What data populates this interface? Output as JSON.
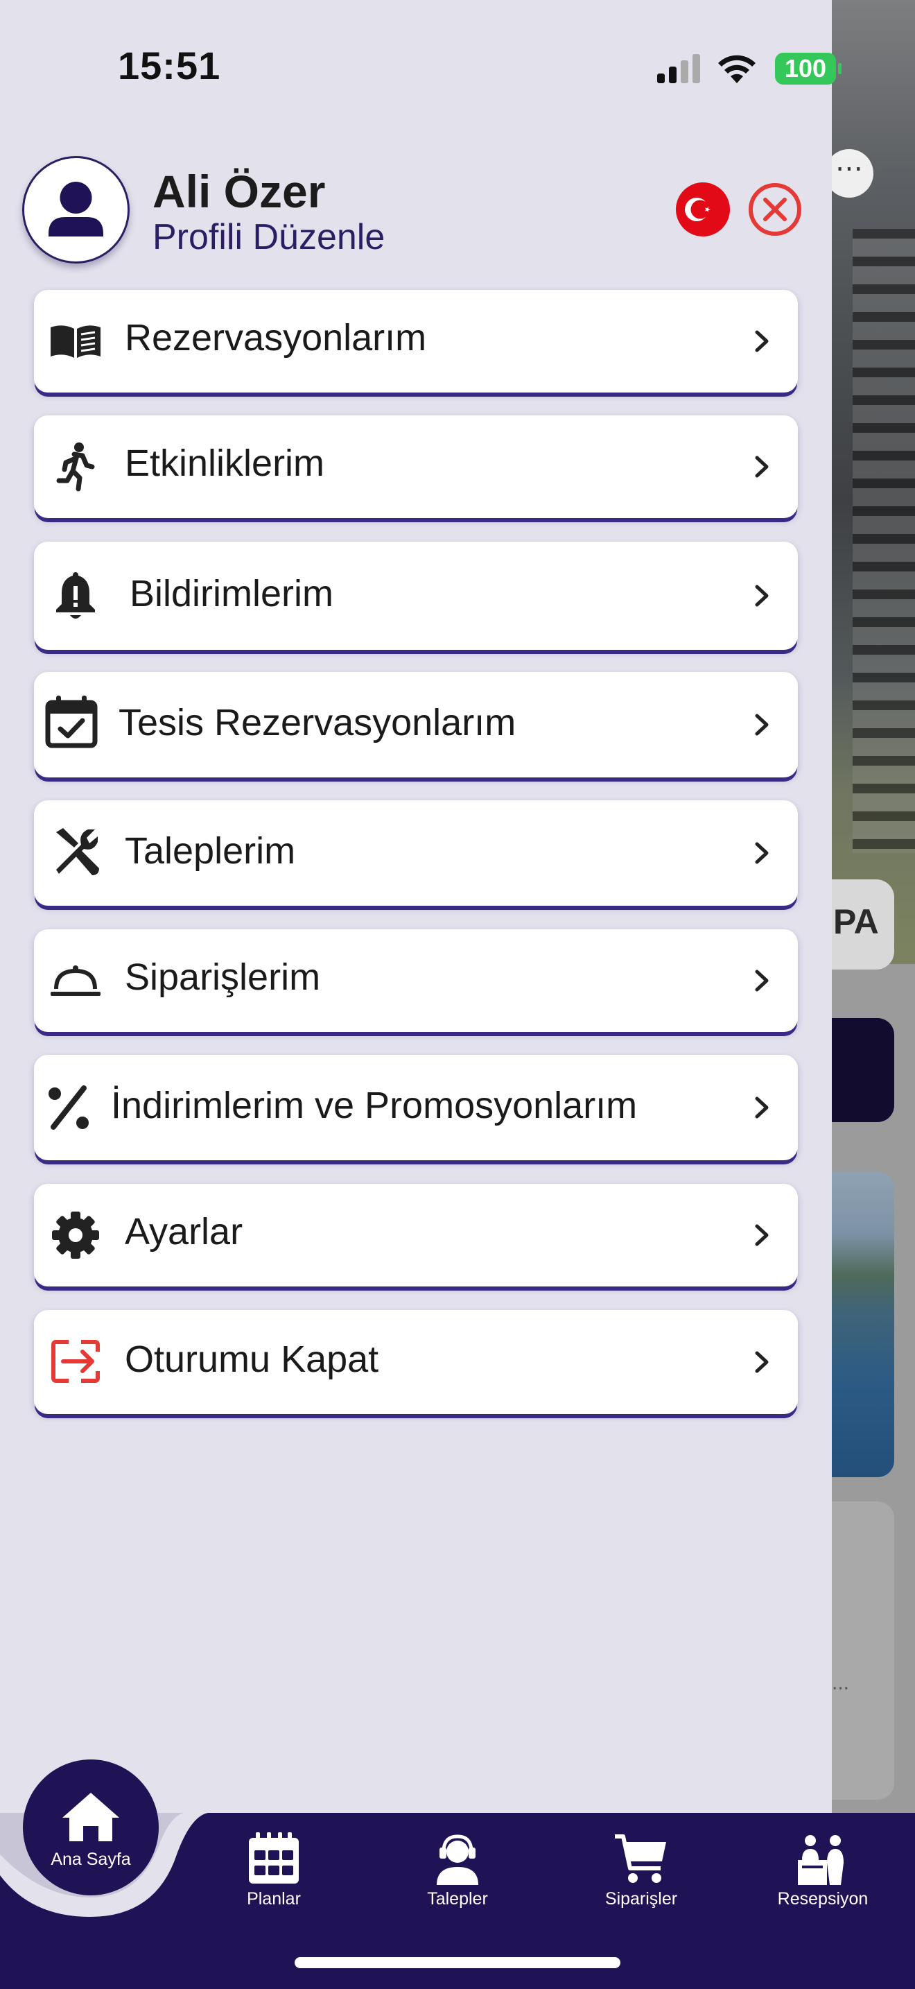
{
  "status_bar": {
    "time": "15:51",
    "battery": "100"
  },
  "profile": {
    "name": "Ali Özer",
    "edit_link": "Profili Düzenle"
  },
  "menu": {
    "items": [
      {
        "label": "Rezervasyonlarım",
        "icon": "book-open-icon"
      },
      {
        "label": "Etkinliklerim",
        "icon": "running-person-icon"
      },
      {
        "label": "Bildirimlerim",
        "icon": "bell-icon"
      },
      {
        "label": "Tesis Rezervasyonlarım",
        "icon": "calendar-check-icon"
      },
      {
        "label": "Taleplerim",
        "icon": "tools-icon"
      },
      {
        "label": "Siparişlerim",
        "icon": "room-service-icon"
      },
      {
        "label": "İndirimlerim ve Promosyonlarım",
        "icon": "percent-icon"
      },
      {
        "label": "Ayarlar",
        "icon": "gear-icon"
      },
      {
        "label": "Oturumu Kapat",
        "icon": "logout-icon"
      }
    ]
  },
  "bottom_nav": {
    "home": "Ana Sayfa",
    "tabs": [
      "Planlar",
      "Talepler",
      "Siparişler",
      "Resepsiyon"
    ]
  },
  "background_app": {
    "pill_text": "PA"
  },
  "colors": {
    "brand": "#1f1356",
    "accent_red": "#e53935",
    "drawer_bg": "#e3e2ec",
    "menu_shadow": "#3b2a85"
  }
}
